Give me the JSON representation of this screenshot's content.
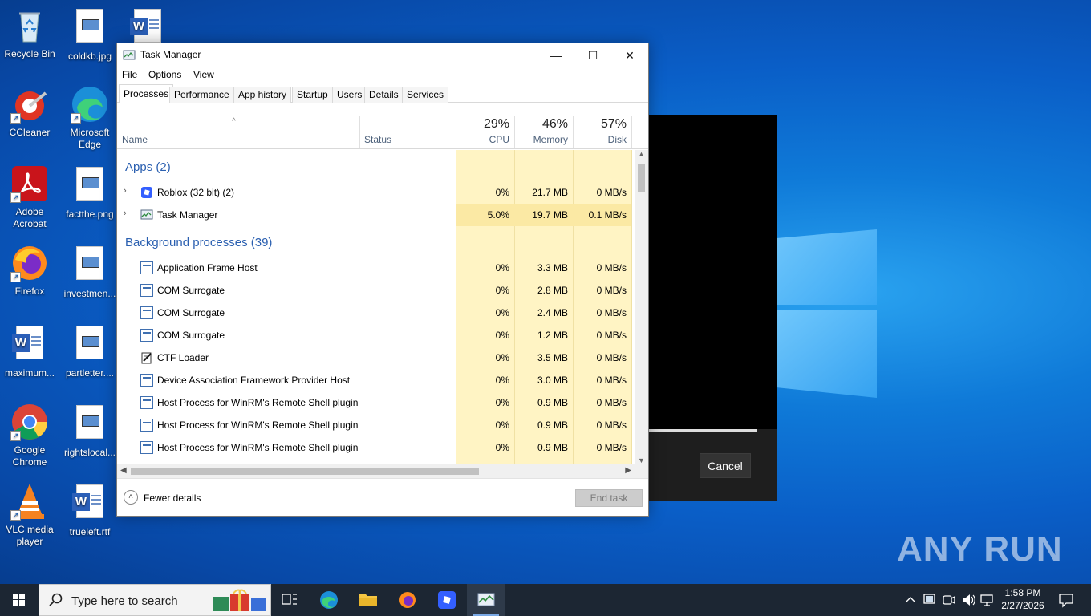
{
  "desktop": {
    "icons": [
      {
        "label": "Recycle Bin",
        "icon": "recycle-bin-icon"
      },
      {
        "label": "coldkb.jpg",
        "icon": "image-file-icon"
      },
      {
        "label": "",
        "icon": "word-document-icon"
      },
      {
        "label": "CCleaner",
        "icon": "ccleaner-icon"
      },
      {
        "label": "Microsoft Edge",
        "icon": "edge-icon"
      },
      {
        "label": "Adobe Acrobat",
        "icon": "acrobat-icon"
      },
      {
        "label": "factthe.png",
        "icon": "image-file-icon"
      },
      {
        "label": "Firefox",
        "icon": "firefox-icon"
      },
      {
        "label": "investmen...",
        "icon": "image-file-icon"
      },
      {
        "label": "maximum...",
        "icon": "word-document-icon"
      },
      {
        "label": "partletter....",
        "icon": "image-file-icon"
      },
      {
        "label": "Google Chrome",
        "icon": "chrome-icon"
      },
      {
        "label": "rightslocal...",
        "icon": "image-file-icon"
      },
      {
        "label": "VLC media player",
        "icon": "vlc-icon"
      },
      {
        "label": "trueleft.rtf",
        "icon": "word-document-icon"
      }
    ],
    "watermark": "ANY RUN"
  },
  "dialog": {
    "cancel_label": "Cancel"
  },
  "task_manager": {
    "title": "Task Manager",
    "menu": [
      "File",
      "Options",
      "View"
    ],
    "tabs": [
      "Processes",
      "Performance",
      "App history",
      "Startup",
      "Users",
      "Details",
      "Services"
    ],
    "active_tab": "Processes",
    "columns": {
      "name": "Name",
      "status": "Status",
      "cpu": {
        "pct": "29%",
        "label": "CPU"
      },
      "memory": {
        "pct": "46%",
        "label": "Memory"
      },
      "disk": {
        "pct": "57%",
        "label": "Disk"
      }
    },
    "groups": {
      "apps": "Apps (2)",
      "background": "Background processes (39)"
    },
    "apps": [
      {
        "name": "Roblox (32 bit) (2)",
        "cpu": "0%",
        "memory": "21.7 MB",
        "disk": "0 MB/s",
        "icon": "roblox-icon"
      },
      {
        "name": "Task Manager",
        "cpu": "5.0%",
        "memory": "19.7 MB",
        "disk": "0.1 MB/s",
        "icon": "task-manager-icon"
      }
    ],
    "background": [
      {
        "name": "Application Frame Host",
        "cpu": "0%",
        "memory": "3.3 MB",
        "disk": "0 MB/s"
      },
      {
        "name": "COM Surrogate",
        "cpu": "0%",
        "memory": "2.8 MB",
        "disk": "0 MB/s"
      },
      {
        "name": "COM Surrogate",
        "cpu": "0%",
        "memory": "2.4 MB",
        "disk": "0 MB/s"
      },
      {
        "name": "COM Surrogate",
        "cpu": "0%",
        "memory": "1.2 MB",
        "disk": "0 MB/s"
      },
      {
        "name": "CTF Loader",
        "cpu": "0%",
        "memory": "3.5 MB",
        "disk": "0 MB/s"
      },
      {
        "name": "Device Association Framework Provider Host",
        "cpu": "0%",
        "memory": "3.0 MB",
        "disk": "0 MB/s"
      },
      {
        "name": "Host Process for WinRM's Remote Shell plugin",
        "cpu": "0%",
        "memory": "0.9 MB",
        "disk": "0 MB/s"
      },
      {
        "name": "Host Process for WinRM's Remote Shell plugin",
        "cpu": "0%",
        "memory": "0.9 MB",
        "disk": "0 MB/s"
      },
      {
        "name": "Host Process for WinRM's Remote Shell plugin",
        "cpu": "0%",
        "memory": "0.9 MB",
        "disk": "0 MB/s"
      }
    ],
    "footer": {
      "fewer_details": "Fewer details",
      "end_task": "End task"
    }
  },
  "taskbar": {
    "search_placeholder": "Type here to search",
    "time": "1:58 PM",
    "date": "2/27/2026"
  }
}
